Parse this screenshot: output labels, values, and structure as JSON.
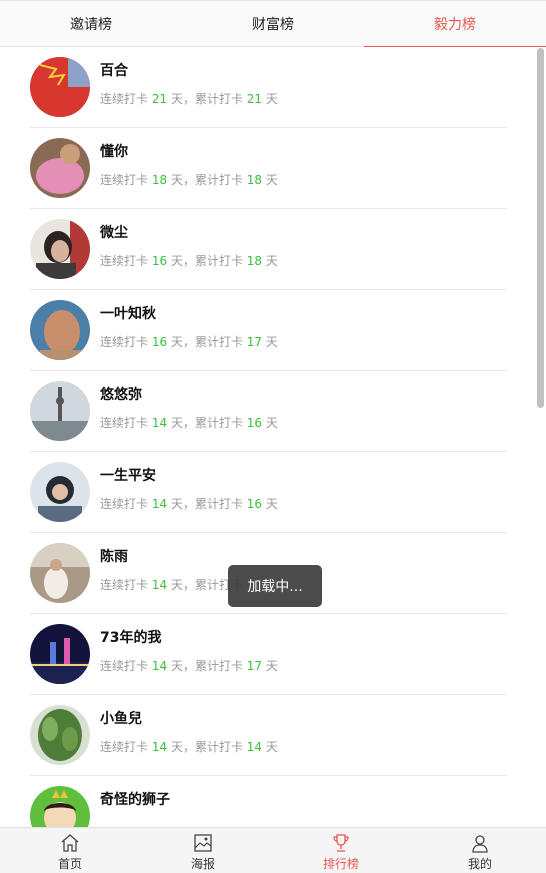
{
  "tabs": [
    {
      "label": "邀请榜",
      "active": false
    },
    {
      "label": "财富榜",
      "active": false
    },
    {
      "label": "毅力榜",
      "active": true
    }
  ],
  "stats_template": {
    "streak_prefix": "连续打卡",
    "sep": "天，累计打卡",
    "suffix": "天"
  },
  "users": [
    {
      "name": "百合",
      "streak": "21",
      "total": "21",
      "avatar": "flag"
    },
    {
      "name": "懂你",
      "streak": "18",
      "total": "18",
      "avatar": "pink"
    },
    {
      "name": "微尘",
      "streak": "16",
      "total": "18",
      "avatar": "woman"
    },
    {
      "name": "一叶知秋",
      "streak": "16",
      "total": "17",
      "avatar": "man"
    },
    {
      "name": "悠悠弥",
      "streak": "14",
      "total": "16",
      "avatar": "tower"
    },
    {
      "name": "一生平安",
      "streak": "14",
      "total": "16",
      "avatar": "child"
    },
    {
      "name": "陈雨",
      "streak": "14",
      "total": "",
      "avatar": "room"
    },
    {
      "name": "73年的我",
      "streak": "14",
      "total": "17",
      "avatar": "night"
    },
    {
      "name": "小鱼兒",
      "streak": "14",
      "total": "14",
      "avatar": "plant"
    },
    {
      "name": "奇怪的狮子",
      "streak": "",
      "total": "",
      "avatar": "cartoon"
    }
  ],
  "toast": "加载中...",
  "nav": [
    {
      "label": "首页",
      "icon": "home-icon",
      "active": false
    },
    {
      "label": "海报",
      "icon": "image-icon",
      "active": false
    },
    {
      "label": "排行榜",
      "icon": "trophy-icon",
      "active": true
    },
    {
      "label": "我的",
      "icon": "user-icon",
      "active": false
    }
  ],
  "colors": {
    "accent": "#e8564f",
    "number": "#3cbf3c"
  }
}
